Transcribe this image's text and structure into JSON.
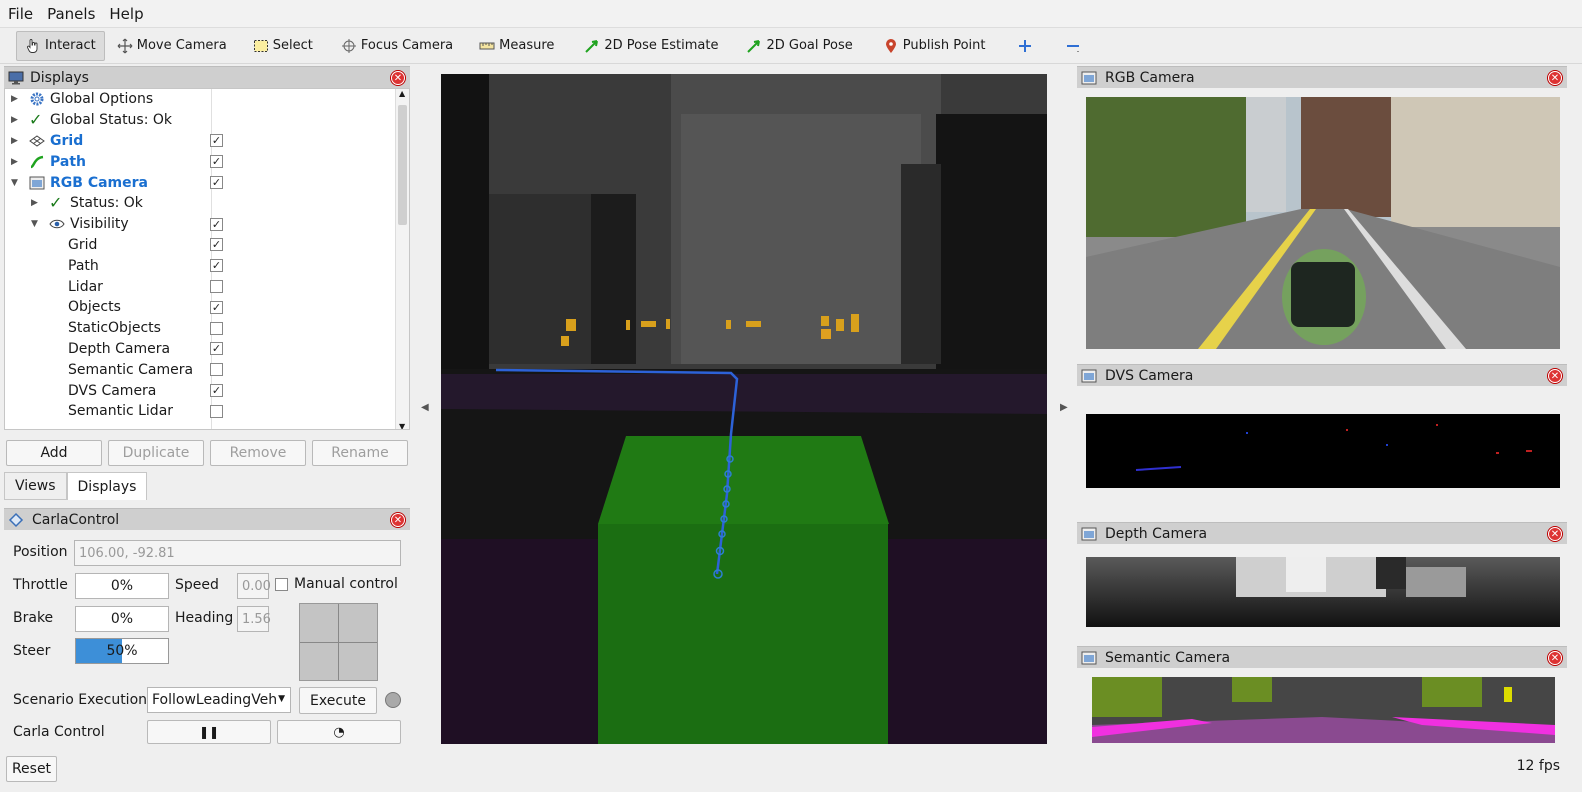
{
  "menu": {
    "file": "File",
    "panels": "Panels",
    "help": "Help"
  },
  "toolbar": {
    "interact": "Interact",
    "move_camera": "Move Camera",
    "select": "Select",
    "focus_camera": "Focus Camera",
    "measure": "Measure",
    "pose_estimate": "2D Pose Estimate",
    "goal_pose": "2D Goal Pose",
    "publish_point": "Publish Point"
  },
  "displays": {
    "title": "Displays",
    "items": [
      {
        "label": "Global Options",
        "checked": null
      },
      {
        "label": "Global Status: Ok",
        "checked": null
      },
      {
        "label": "Grid",
        "checked": true
      },
      {
        "label": "Path",
        "checked": true
      },
      {
        "label": "RGB Camera",
        "checked": true
      },
      {
        "label": "Status: Ok",
        "checked": null
      },
      {
        "label": "Visibility",
        "checked": true
      },
      {
        "label": "Grid",
        "checked": true
      },
      {
        "label": "Path",
        "checked": true
      },
      {
        "label": "Lidar",
        "checked": false
      },
      {
        "label": "Objects",
        "checked": true
      },
      {
        "label": "StaticObjects",
        "checked": false
      },
      {
        "label": "Depth Camera",
        "checked": true
      },
      {
        "label": "Semantic Camera",
        "checked": false
      },
      {
        "label": "DVS Camera",
        "checked": true
      },
      {
        "label": "Semantic Lidar",
        "checked": false
      }
    ],
    "buttons": {
      "add": "Add",
      "duplicate": "Duplicate",
      "remove": "Remove",
      "rename": "Rename"
    },
    "tabs": {
      "views": "Views",
      "displays": "Displays"
    }
  },
  "carla": {
    "title": "CarlaControl",
    "position_label": "Position",
    "position_value": "106.00, -92.81",
    "throttle_label": "Throttle",
    "throttle_value": "0%",
    "speed_label": "Speed",
    "speed_value": "0.00",
    "manual_label": "Manual control",
    "brake_label": "Brake",
    "brake_value": "0%",
    "heading_label": "Heading",
    "heading_value": "1.56",
    "steer_label": "Steer",
    "steer_value": "50%",
    "steer_fraction": 0.5,
    "scenario_label": "Scenario Execution",
    "scenario_value": "FollowLeadingVeh",
    "execute_label": "Execute",
    "control_label": "Carla Control",
    "reset_label": "Reset"
  },
  "cameras": {
    "rgb": "RGB Camera",
    "dvs": "DVS Camera",
    "depth": "Depth Camera",
    "semantic": "Semantic Camera"
  },
  "status": {
    "fps": "12 fps"
  },
  "colors": {
    "accent": "#1a6fd0",
    "path_green": "#1fa31f",
    "close_red": "#d33333",
    "ground_box": "#1b6e12"
  }
}
